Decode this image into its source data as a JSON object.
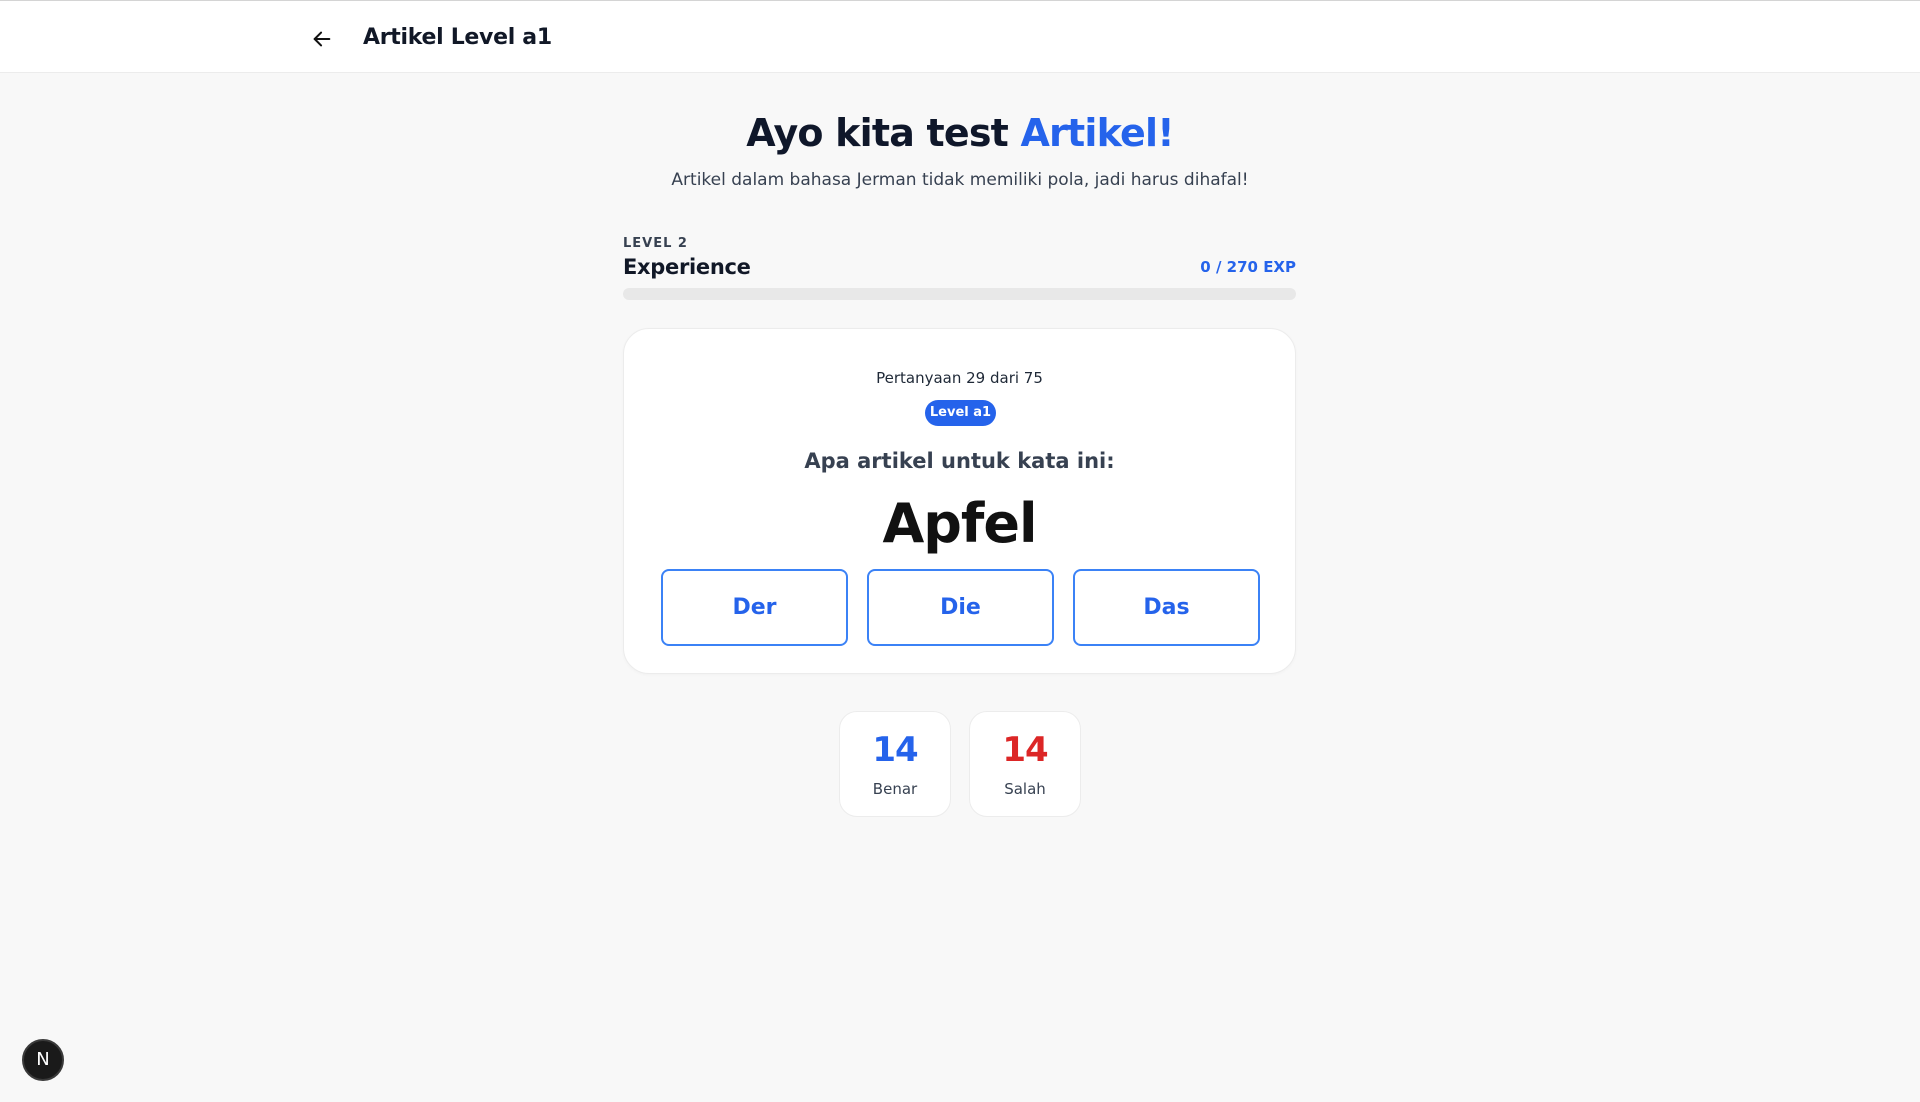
{
  "header": {
    "title": "Artikel Level a1",
    "back_icon": "arrow-left-icon"
  },
  "hero": {
    "title_prefix": "Ayo kita test ",
    "title_accent": "Artikel!",
    "subtitle": "Artikel dalam bahasa Jerman tidak memiliki pola, jadi harus dihafal!"
  },
  "experience": {
    "level": "LEVEL 2",
    "label": "Experience",
    "value_text": "0 / 270 EXP",
    "progress_fraction": 0
  },
  "quiz": {
    "counter": "Pertanyaan 29 dari 75",
    "badge": "Level a1",
    "question": "Apa artikel untuk kata ini:",
    "word": "Apfel",
    "options": [
      "Der",
      "Die",
      "Das"
    ]
  },
  "stats": {
    "correct": {
      "value": "14",
      "label": "Benar"
    },
    "wrong": {
      "value": "14",
      "label": "Salah"
    }
  },
  "floating_badge": {
    "label": "N"
  },
  "colors": {
    "accent": "#2563eb",
    "error": "#dc2626",
    "background": "#f8f8f8"
  }
}
